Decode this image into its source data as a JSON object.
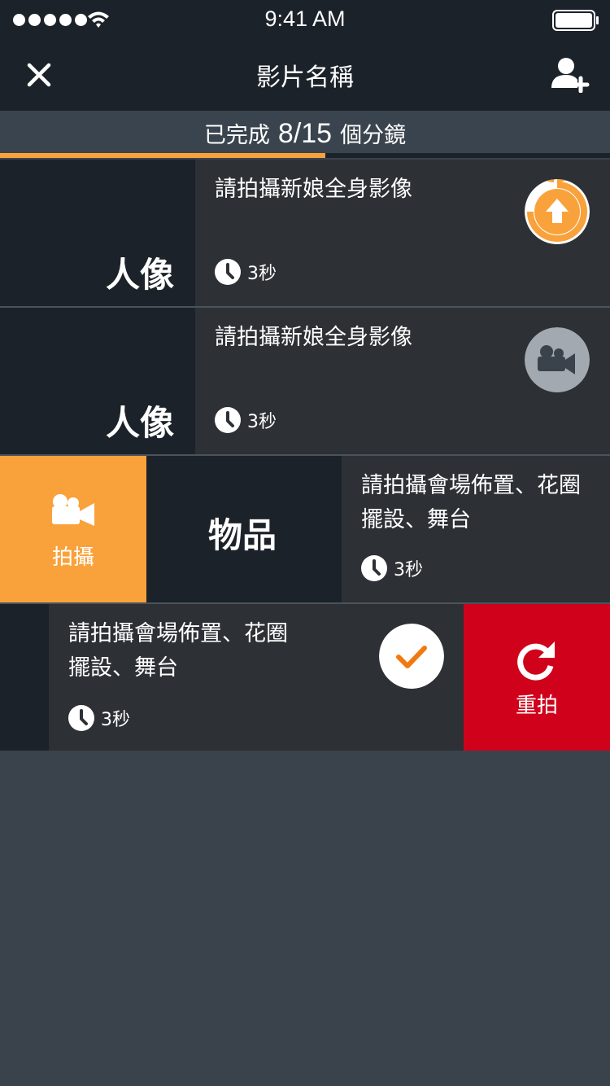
{
  "status_bar": {
    "time": "9:41 AM",
    "icons": [
      "signal-dots-icon",
      "wifi-icon",
      "battery-icon"
    ]
  },
  "nav": {
    "title": "影片名稱",
    "close_icon": "close-icon",
    "add_user_icon": "add-user-icon"
  },
  "progress": {
    "prefix": "已完成",
    "count": "8/15",
    "suffix": "個分鏡",
    "completed": 8,
    "total": 15,
    "fraction": 0.5333
  },
  "shots": [
    {
      "category": "人像",
      "title": "請拍攝新娘全身影像",
      "duration": "3秒",
      "status_icon": "upload-icon"
    },
    {
      "category": "人像",
      "title": "請拍攝新娘全身影像",
      "duration": "3秒",
      "status_icon": "video-camera-icon"
    },
    {
      "category": "物品",
      "title_lines": [
        "請拍攝會場佈置、花圈",
        "擺設、舞台"
      ],
      "duration": "3秒",
      "swipe_action": "拍攝",
      "swipe_action_icon": "video-camera-icon"
    },
    {
      "title_lines": [
        "請拍攝會場佈置、花圈",
        "擺設、舞台"
      ],
      "duration": "3秒",
      "status_icon": "checkmark-icon",
      "swipe_action": "重拍",
      "swipe_action_icon": "redo-icon"
    }
  ],
  "colors": {
    "accent": "#f9a23b",
    "danger": "#d0021b",
    "dark_bg": "#1c2229",
    "row_bg": "#2d3136",
    "page_bg": "#3a424b",
    "disabled_gray": "#a3a9b0"
  }
}
